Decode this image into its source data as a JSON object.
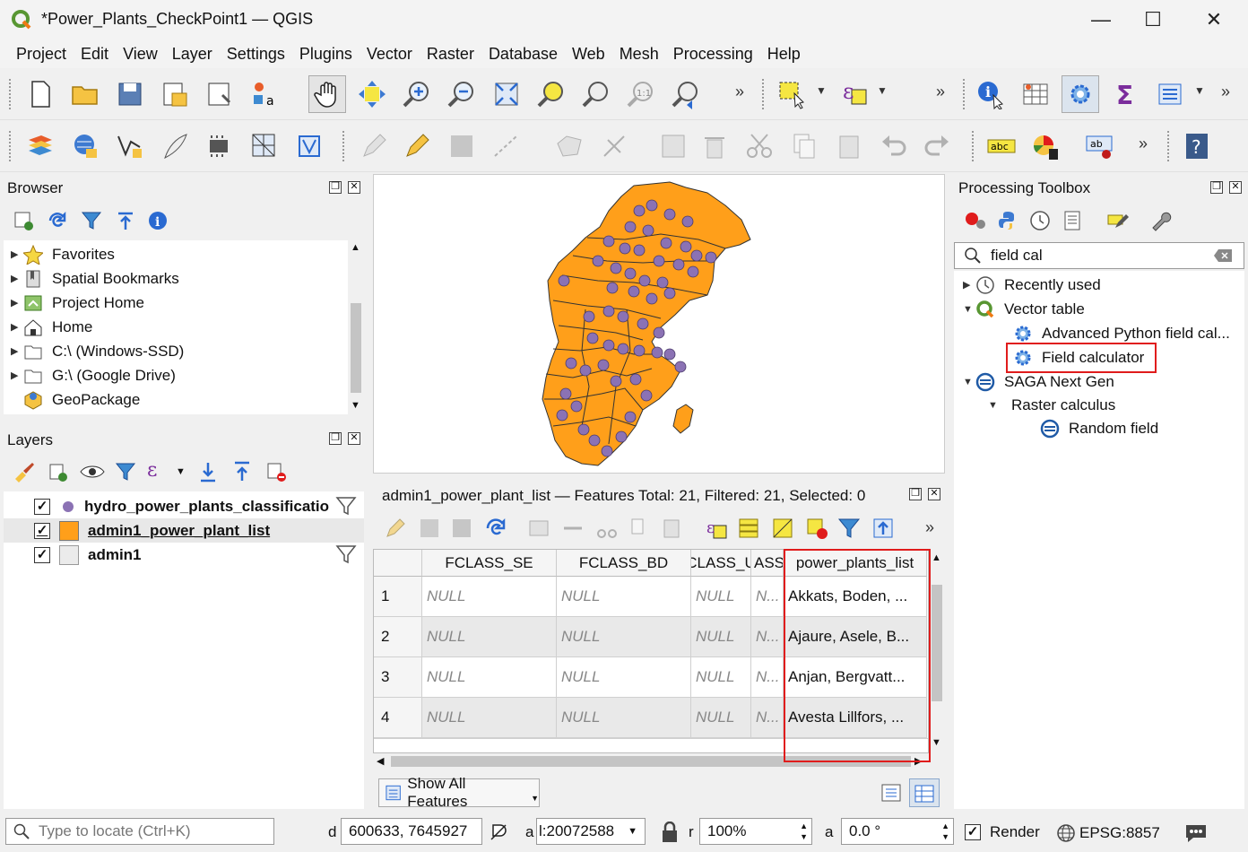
{
  "window": {
    "title": "*Power_Plants_CheckPoint1 — QGIS"
  },
  "menu": [
    "Project",
    "Edit",
    "View",
    "Layer",
    "Settings",
    "Plugins",
    "Vector",
    "Raster",
    "Database",
    "Web",
    "Mesh",
    "Processing",
    "Help"
  ],
  "browser": {
    "title": "Browser",
    "items": [
      {
        "label": "Favorites",
        "icon": "star-icon"
      },
      {
        "label": "Spatial Bookmarks",
        "icon": "bookmark-icon"
      },
      {
        "label": "Project Home",
        "icon": "project-home-icon"
      },
      {
        "label": "Home",
        "icon": "home-icon"
      },
      {
        "label": "C:\\ (Windows-SSD)",
        "icon": "drive-icon"
      },
      {
        "label": "G:\\ (Google Drive)",
        "icon": "drive-icon"
      },
      {
        "label": "GeoPackage",
        "icon": "geopackage-icon"
      }
    ]
  },
  "layers": {
    "title": "Layers",
    "items": [
      {
        "label": "hydro_power_plants_classificatio",
        "checked": "✓"
      },
      {
        "label": "admin1_power_plant_list",
        "checked": "✓"
      },
      {
        "label": "admin1",
        "checked": "✓"
      }
    ]
  },
  "attribute_table": {
    "title": "admin1_power_plant_list — Features Total: 21, Filtered: 21, Selected: 0",
    "columns": [
      "FCLASS_SE",
      "FCLASS_BD",
      "CLASS_U",
      "ASS_",
      "power_plants_list"
    ],
    "rows": [
      {
        "n": "1",
        "c1": "NULL",
        "c2": "NULL",
        "c3": "NULL",
        "c4": "N...",
        "c5": "Akkats, Boden, ..."
      },
      {
        "n": "2",
        "c1": "NULL",
        "c2": "NULL",
        "c3": "NULL",
        "c4": "N...",
        "c5": "Ajaure, Asele, B..."
      },
      {
        "n": "3",
        "c1": "NULL",
        "c2": "NULL",
        "c3": "NULL",
        "c4": "N...",
        "c5": "Anjan, Bergvatt..."
      },
      {
        "n": "4",
        "c1": "NULL",
        "c2": "NULL",
        "c3": "NULL",
        "c4": "N...",
        "c5": "Avesta Lillfors, ..."
      }
    ],
    "show_all": "Show All Features"
  },
  "toolbox": {
    "title": "Processing Toolbox",
    "search_value": "field cal",
    "items": [
      {
        "label": "Recently used"
      },
      {
        "label": "Vector table"
      },
      {
        "label": "Advanced Python field cal..."
      },
      {
        "label": "Field calculator"
      },
      {
        "label": "SAGA Next Gen"
      },
      {
        "label": "Raster calculus"
      },
      {
        "label": "Random field"
      }
    ]
  },
  "status": {
    "locate_placeholder": "Type to locate (Ctrl+K)",
    "coord_prefix": "d",
    "coordinate": "600633, 7645927",
    "scale_prefix": "a",
    "scale": "l:20072588",
    "mag_prefix": "r",
    "magnifier": "100%",
    "rot_prefix": "a",
    "rotation": "0.0 °",
    "render": "Render",
    "crs": "EPSG:8857"
  },
  "colors": {
    "admin_fill": "#ff9f1a",
    "point_fill": "#8b72b4",
    "highlight": "#e01c1c"
  }
}
